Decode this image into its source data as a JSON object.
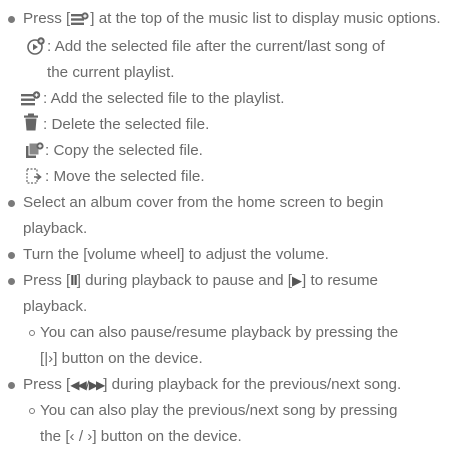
{
  "intro": {
    "pre": "Press [",
    "icon": "menu-options-icon",
    "post": "] at the top of the music list to display music options."
  },
  "options": [
    {
      "icon": "add-after-current-icon",
      "text": ": Add the selected file after the current/last song of"
    },
    {
      "icon": "add-to-playlist-icon",
      "text": ": Add the selected file to the playlist."
    },
    {
      "icon": "trash-icon",
      "text": ": Delete the selected file."
    },
    {
      "icon": "copy-file-icon",
      "text": ": Copy the selected file."
    },
    {
      "icon": "move-file-icon",
      "text": ": Move the selected file."
    }
  ],
  "option_cont": "the current playlist.",
  "bullet2": {
    "line1": "Select an album cover from the home screen to begin",
    "line2": "playback."
  },
  "bullet3": "Turn the [volume wheel] to adjust the volume.",
  "bullet4": {
    "a": "Press [",
    "pause_glyph": "II",
    "b": "] during playback to pause and [",
    "play_glyph": "▶",
    "c": "] to resume",
    "line2": "playback."
  },
  "sub1": {
    "line1": "You can also pause/resume playback by pressing the",
    "line2": "[|›] button on the device."
  },
  "bullet5": {
    "a": "Press [",
    "glyph": "◀◀ / ▶▶",
    "b": "] during playback for the previous/next song."
  },
  "sub2": {
    "line1": "You can also play the previous/next song by pressing",
    "line2": "the [‹ / ›] button on the device."
  }
}
